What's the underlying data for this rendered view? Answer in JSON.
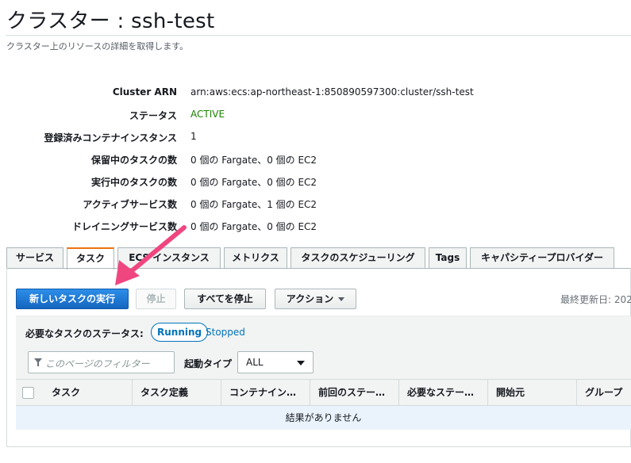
{
  "header": {
    "title": "クラスター : ssh-test",
    "description": "クラスター上のリソースの詳細を取得します。"
  },
  "details": [
    {
      "label": "Cluster ARN",
      "value": "arn:aws:ecs:ap-northeast-1:850890597300:cluster/ssh-test"
    },
    {
      "label": "ステータス",
      "value": "ACTIVE"
    },
    {
      "label": "登録済みコンテナインスタンス",
      "value": "1"
    },
    {
      "label": "保留中のタスクの数",
      "value": "0 個の Fargate、0 個の EC2"
    },
    {
      "label": "実行中のタスクの数",
      "value": "0 個の Fargate、0 個の EC2"
    },
    {
      "label": "アクティブサービス数",
      "value": "0 個の Fargate、1 個の EC2"
    },
    {
      "label": "ドレイニングサービス数",
      "value": "0 個の Fargate、0 個の EC2"
    }
  ],
  "tabs": [
    {
      "label": "サービス"
    },
    {
      "label": "タスク",
      "selected": true
    },
    {
      "label": "ECS インスタンス"
    },
    {
      "label": "メトリクス"
    },
    {
      "label": "タスクのスケジューリング"
    },
    {
      "label": "Tags"
    },
    {
      "label": "キャパシティープロバイダー"
    }
  ],
  "toolbar": {
    "run_new_task": "新しいタスクの実行",
    "stop": "停止",
    "stop_all": "すべてを停止",
    "actions": "アクション",
    "last_updated": "最終更新日: 202"
  },
  "status_filter": {
    "label": "必要なタスクのステータス:",
    "running": "Running",
    "stopped": "Stopped"
  },
  "filter": {
    "placeholder": "このページのフィルター",
    "launch_type_label": "起動タイプ",
    "launch_type_value": "ALL"
  },
  "table": {
    "columns": [
      "タスク",
      "タスク定義",
      "コンテナイン…",
      "前回のステー…",
      "必要なステー…",
      "開始元",
      "グループ"
    ],
    "empty_message": "結果がありません"
  },
  "colors": {
    "accent_tab": "#ec7211",
    "primary_button": "#1466c0",
    "link": "#0073bb",
    "active_status": "#1d8102",
    "annotation_arrow": "#f0467f"
  }
}
